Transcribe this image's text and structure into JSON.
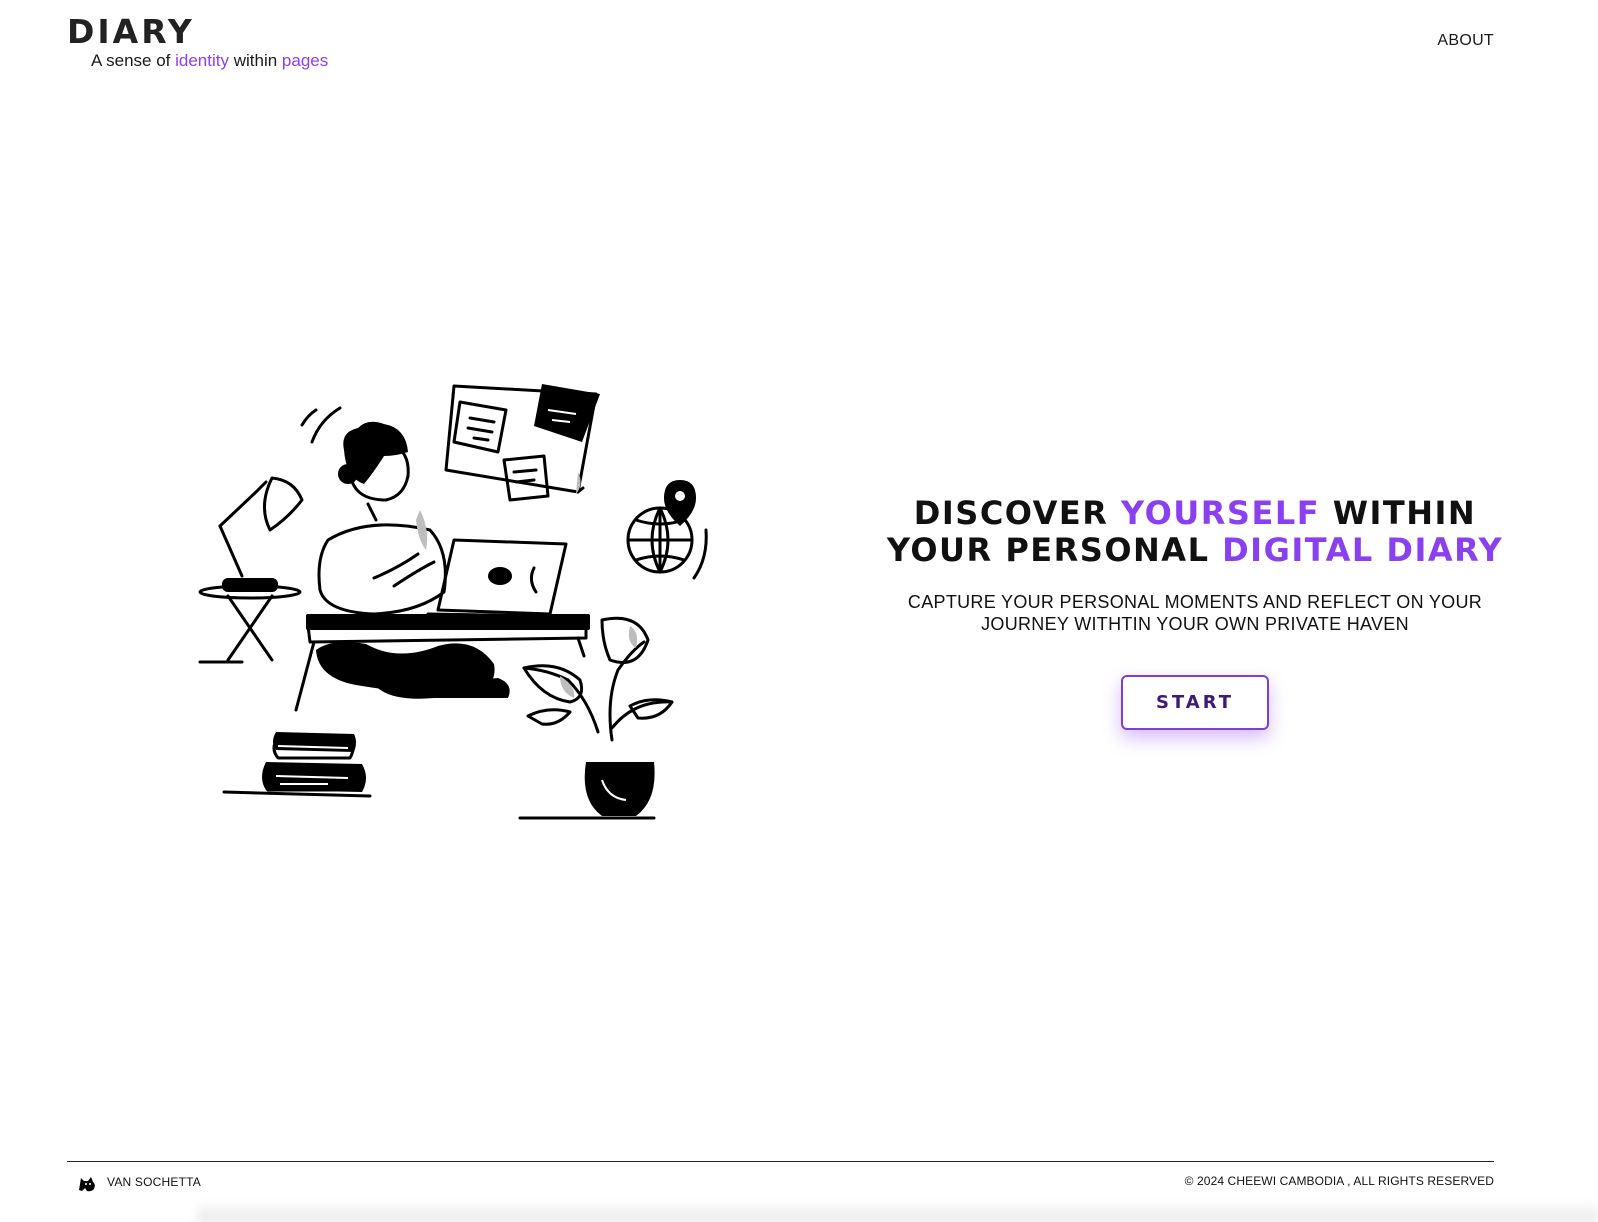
{
  "header": {
    "brand": "DIARY",
    "tagline": {
      "part1": "A sense of ",
      "part2": "identity",
      "part3": " within ",
      "part4": "pages"
    },
    "nav": {
      "about": "ABOUT"
    }
  },
  "hero": {
    "title": {
      "part1": "DISCOVER ",
      "part2": "YOURSELF",
      "part3": " WITHIN YOUR PERSONAL ",
      "part4": "DIGITAL DIARY"
    },
    "subtitle": "CAPTURE YOUR PERSONAL MOMENTS AND REFLECT ON YOUR JOURNEY WITHTIN YOUR OWN PRIVATE HAVEN",
    "cta": "START",
    "illustration_icon": "woman-working-at-laptop-illustration"
  },
  "footer": {
    "author": "VAN SOCHETTA",
    "author_icon": "cat-logo-icon",
    "copyright": "© 2024 CHEEWI CAMBODIA , ALL RIGHTS RESERVED"
  },
  "colors": {
    "accent": "#8a3ff0",
    "button_text": "#3d1a78",
    "text": "#111111",
    "background": "#ffffff"
  }
}
